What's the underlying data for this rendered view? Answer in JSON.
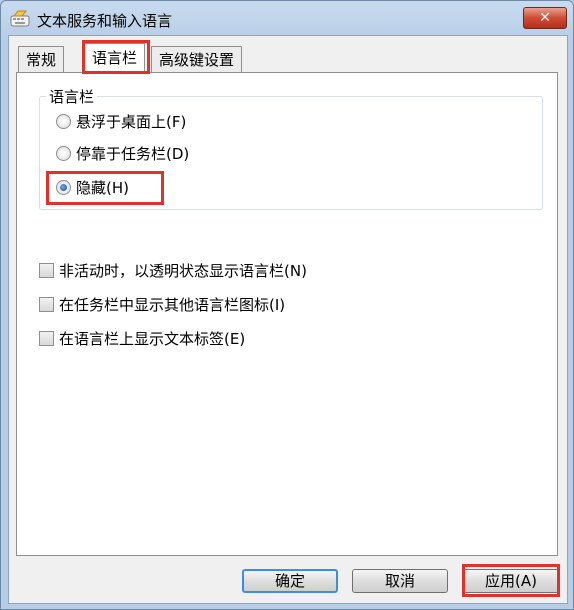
{
  "window": {
    "title": "文本服务和输入语言",
    "close_symbol": "✕",
    "icon": "keyboard-icon"
  },
  "tabs": [
    {
      "label": "常规",
      "active": false
    },
    {
      "label": "语言栏",
      "active": true
    },
    {
      "label": "高级键设置",
      "active": false
    }
  ],
  "languagebar": {
    "group_title": "语言栏",
    "options": [
      {
        "label": "悬浮于桌面上(F)",
        "checked": false
      },
      {
        "label": "停靠于任务栏(D)",
        "checked": false
      },
      {
        "label": "隐藏(H)",
        "checked": true
      }
    ],
    "checkboxes": [
      {
        "label": "非活动时，以透明状态显示语言栏(N)",
        "checked": false
      },
      {
        "label": "在任务栏中显示其他语言栏图标(I)",
        "checked": false
      },
      {
        "label": "在语言栏上显示文本标签(E)",
        "checked": false
      }
    ]
  },
  "buttons": {
    "ok": "确定",
    "cancel": "取消",
    "apply": "应用(A)"
  },
  "colors": {
    "highlight": "#e0312b",
    "frame": "#bcd2ea"
  }
}
